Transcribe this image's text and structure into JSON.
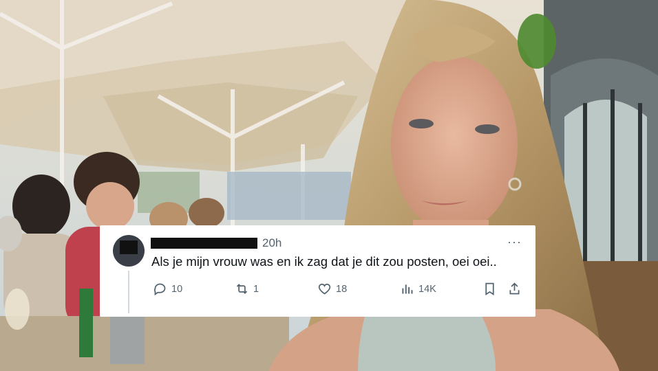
{
  "tweet": {
    "author_redacted": "",
    "time": "20h",
    "more_label": "···",
    "text": "Als je mijn vrouw was en ik zag dat je dit zou posten, oei oei..",
    "replies": "10",
    "reposts": "1",
    "likes": "18",
    "views": "14K"
  },
  "icons": [
    "reply-icon",
    "repost-icon",
    "like-icon",
    "views-icon",
    "bookmark-icon",
    "share-icon"
  ],
  "colors": {
    "icon_gray": "#536471",
    "text": "#0f1419",
    "card_bg": "#ffffff"
  }
}
